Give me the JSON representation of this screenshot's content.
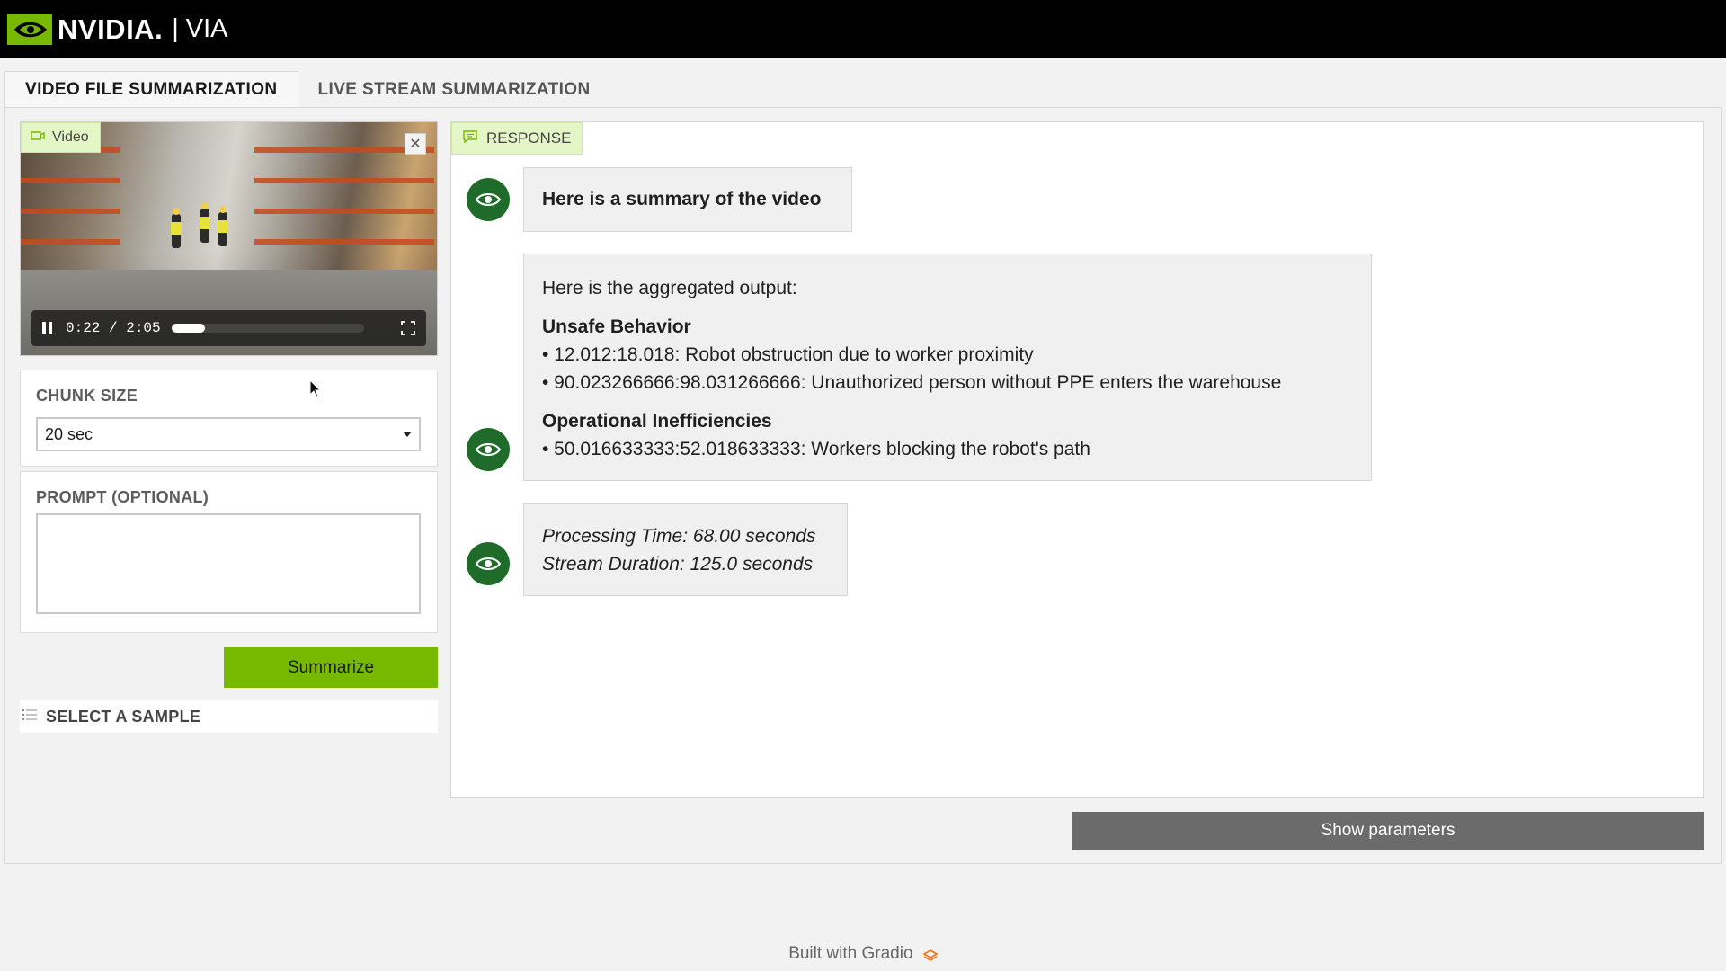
{
  "header": {
    "brand": "NVIDIA.",
    "product": "| VIA"
  },
  "tabs": [
    {
      "label": "VIDEO FILE SUMMARIZATION",
      "active": true
    },
    {
      "label": "LIVE STREAM SUMMARIZATION",
      "active": false
    }
  ],
  "video": {
    "label": "Video",
    "current_time": "0:22",
    "duration": "2:05",
    "time_display": "0:22 / 2:05",
    "progress_fraction": 0.176
  },
  "chunk_size": {
    "label": "CHUNK SIZE",
    "selected": "20 sec"
  },
  "prompt": {
    "label": "PROMPT (OPTIONAL)",
    "value": "",
    "placeholder": ""
  },
  "actions": {
    "summarize": "Summarize",
    "show_parameters": "Show parameters"
  },
  "samples": {
    "label": "SELECT A SAMPLE"
  },
  "response": {
    "label": "RESPONSE",
    "messages": [
      {
        "text": "Here is a summary of the video"
      },
      {
        "intro": "Here is the aggregated output:",
        "section1_title": "Unsafe Behavior",
        "section1_items": [
          "• 12.012:18.018: Robot obstruction due to worker proximity",
          "• 90.023266666:98.031266666: Unauthorized person without PPE enters the warehouse"
        ],
        "section2_title": "Operational Inefficiencies",
        "section2_items": [
          "• 50.016633333:52.018633333: Workers blocking the robot's path"
        ]
      },
      {
        "line1": "Processing Time: 68.00 seconds",
        "line2": "Stream Duration: 125.0 seconds"
      }
    ]
  },
  "footer": {
    "text": "Built with Gradio"
  },
  "colors": {
    "accent": "#76b900",
    "header_bg": "#000000",
    "label_bg": "#e4f5c6",
    "avatar": "#1f6b2a"
  }
}
